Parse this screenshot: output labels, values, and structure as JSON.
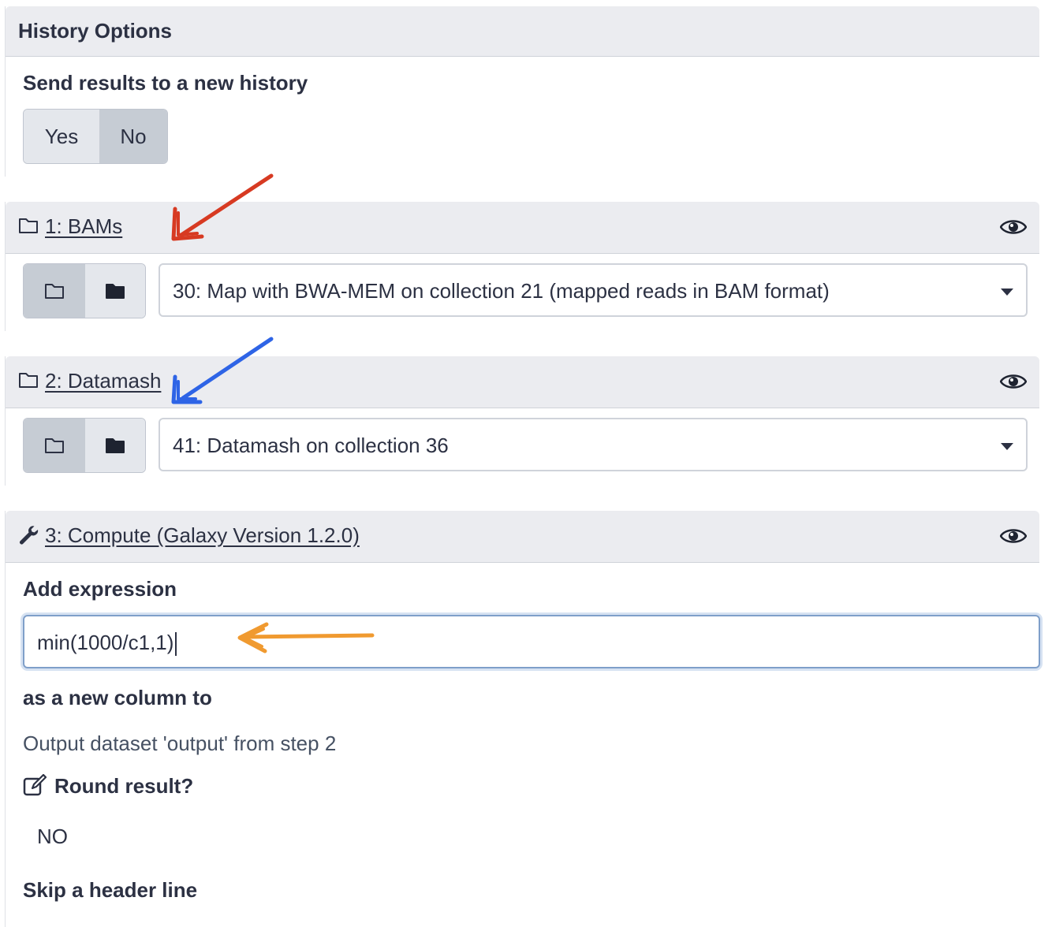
{
  "history_options": {
    "title": "History Options",
    "send_label": "Send results to a new history",
    "yes_label": "Yes",
    "no_label": "No",
    "selected": "No"
  },
  "steps": [
    {
      "header": "1: BAMs",
      "header_icon": "folder-outline-icon",
      "selected_value": "30: Map with BWA-MEM on collection 21 (mapped reads in BAM format)"
    },
    {
      "header": "2: Datamash",
      "header_icon": "folder-outline-icon",
      "selected_value": "41: Datamash on collection 36"
    },
    {
      "header": "3: Compute (Galaxy Version 1.2.0)",
      "header_icon": "wrench-icon",
      "add_expression_label": "Add expression",
      "expression_value": "min(1000/c1,1)",
      "new_column_label": "as a new column to",
      "new_column_value": "Output dataset 'output' from step 2",
      "round_label": "Round result?",
      "round_value": "NO",
      "skip_header_label": "Skip a header line"
    }
  ],
  "annotations": {
    "arrow_colors": {
      "red": "#d73a22",
      "blue": "#2e64e6",
      "orange": "#f09a30"
    }
  },
  "colors": {
    "header_bg": "#ebecf0",
    "text": "#2c3143",
    "button_light": "#e4e7ec",
    "button_active": "#c6ccd4",
    "input_focus_border": "#7f9fc9"
  }
}
